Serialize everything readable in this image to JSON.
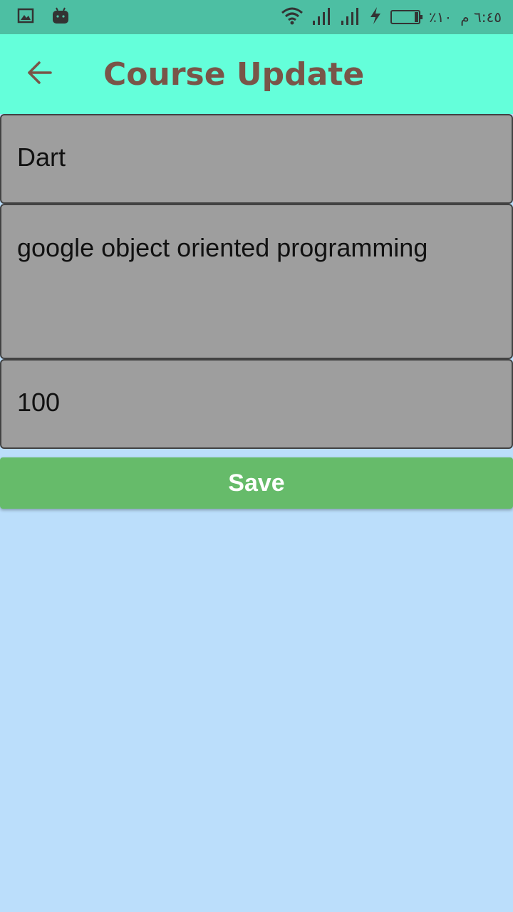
{
  "status_bar": {
    "time": "٦:٤٥ م",
    "battery_percent": "٪١٠",
    "icons": [
      "gallery-icon",
      "android-icon",
      "wifi-icon",
      "signal-icon",
      "signal-icon",
      "charging-icon",
      "battery-icon"
    ]
  },
  "app_bar": {
    "title": "Course Update",
    "back_icon": "arrow-back-icon",
    "background": "#64ffda",
    "title_color": "#795548"
  },
  "form": {
    "name_value": "Dart",
    "description_value": "google object oriented programming",
    "price_value": "100",
    "field_background": "#9e9e9e"
  },
  "actions": {
    "save_label": "Save",
    "save_color": "#66bb6a"
  },
  "page_background": "#bbdefb"
}
